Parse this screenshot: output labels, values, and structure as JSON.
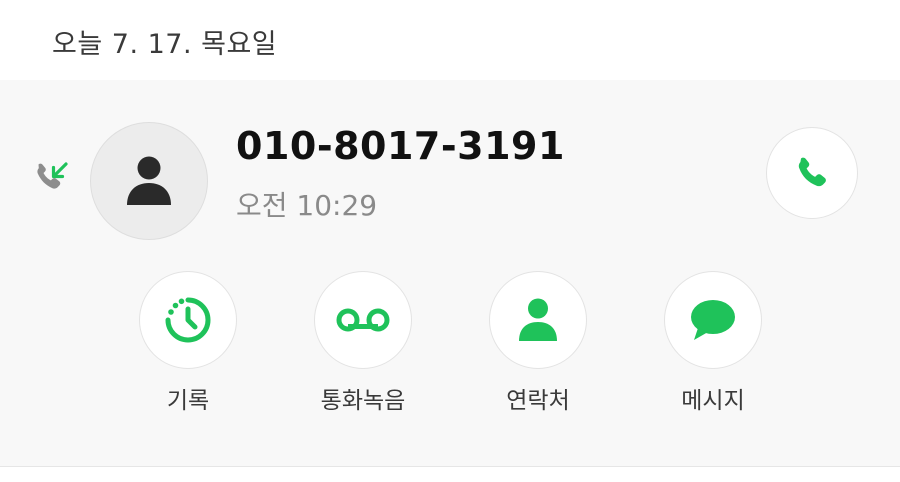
{
  "header": {
    "date_label": "오늘 7. 17. 목요일"
  },
  "call_entry": {
    "call_type_icon": "incoming-call-icon",
    "phone_number": "010-8017-3191",
    "time": "오전 10:29",
    "avatar_icon": "person-icon",
    "call_button_icon": "phone-icon"
  },
  "actions": [
    {
      "label": "기록",
      "icon": "history-icon"
    },
    {
      "label": "통화녹음",
      "icon": "voicemail-icon"
    },
    {
      "label": "연락처",
      "icon": "contact-icon"
    },
    {
      "label": "메시지",
      "icon": "message-icon"
    }
  ],
  "colors": {
    "accent_green": "#1fc25a",
    "card_background": "#f8f8f8",
    "avatar_background": "#ececec",
    "number_text": "#111111",
    "secondary_text": "#8a8a8a"
  }
}
